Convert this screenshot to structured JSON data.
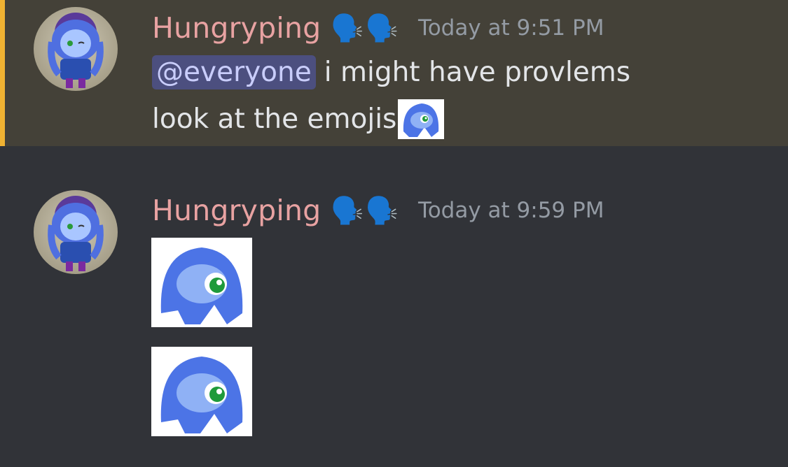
{
  "messages": [
    {
      "username": "Hungryping",
      "status_icons": [
        "🗣️",
        "🗣️"
      ],
      "timestamp": "Today at 9:51 PM",
      "mention": "@everyone",
      "line1_text": "i might have provlems",
      "line2_text": "look at the emojis",
      "highlighted": true
    },
    {
      "username": "Hungryping",
      "status_icons": [
        "🗣️",
        "🗣️"
      ],
      "timestamp": "Today at 9:59 PM",
      "attachments": [
        "blue-blob-sticker",
        "blue-blob-sticker"
      ]
    }
  ],
  "colors": {
    "background": "#313338",
    "mention_highlight_bg": "#444138",
    "mention_bar": "#f0b232",
    "username": "#e8a2a2",
    "timestamp": "#949ba4",
    "mention_pill": "#4c4f7f"
  }
}
